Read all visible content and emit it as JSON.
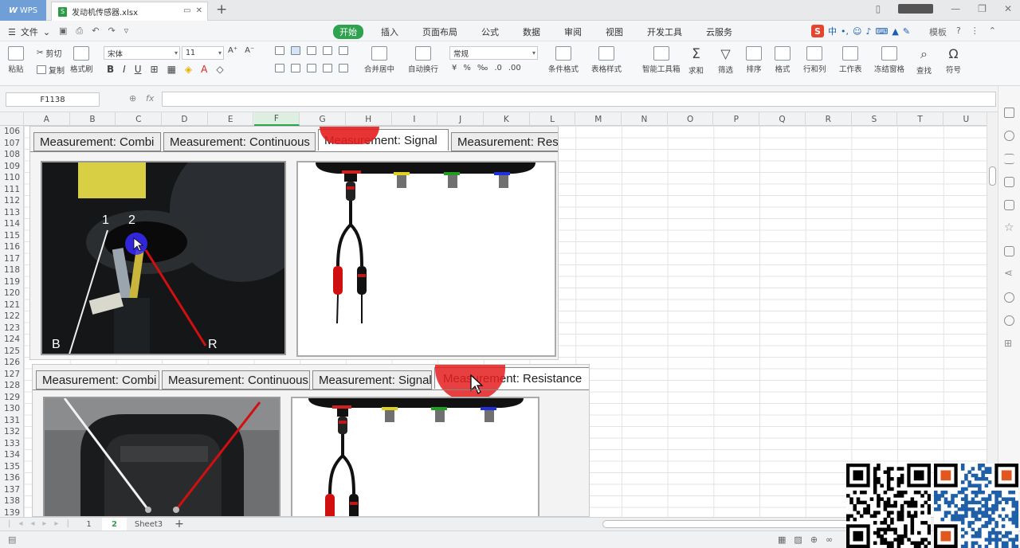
{
  "app": {
    "name": "WPS"
  },
  "doc_tab": {
    "title": "发动机传感器.xlsx"
  },
  "menu": {
    "file": "文件"
  },
  "tabs": [
    {
      "label": "开始",
      "active": true
    },
    {
      "label": "插入"
    },
    {
      "label": "页面布局"
    },
    {
      "label": "公式"
    },
    {
      "label": "数据"
    },
    {
      "label": "审阅"
    },
    {
      "label": "视图"
    },
    {
      "label": "开发工具"
    },
    {
      "label": "云服务"
    }
  ],
  "ime": {
    "logo": "S",
    "lang": "中",
    "dot": "•,",
    "right_label": "模板"
  },
  "ribbon": {
    "paste": "粘贴",
    "cut": "剪切",
    "copy": "复制",
    "format_painter": "格式刷",
    "font_name": "宋体",
    "font_size": "11",
    "bold": "B",
    "italic": "I",
    "underline": "U",
    "merge_center": "合并居中",
    "auto_wrap": "自动换行",
    "number_format": "常规",
    "percent": "%",
    "conditional_format": "条件格式",
    "table_style": "表格样式",
    "smart_toolbox": "智能工具箱",
    "sum": "求和",
    "filter": "筛选",
    "sort": "排序",
    "format": "格式",
    "row_col": "行和列",
    "worksheet": "工作表",
    "freeze": "冻结窗格",
    "find": "查找",
    "symbol": "符号"
  },
  "formula_bar": {
    "cell_ref": "F1138",
    "fx": "fx",
    "content": ""
  },
  "columns": [
    "A",
    "B",
    "C",
    "D",
    "E",
    "F",
    "G",
    "H",
    "I",
    "J",
    "K",
    "L",
    "M",
    "N",
    "O",
    "P",
    "Q",
    "R",
    "S",
    "T",
    "U"
  ],
  "rows": [
    "106",
    "107",
    "108",
    "109",
    "110",
    "111",
    "112",
    "113",
    "114",
    "115",
    "116",
    "117",
    "118",
    "119",
    "120",
    "121",
    "122",
    "123",
    "124",
    "125",
    "126",
    "127",
    "128",
    "129",
    "130",
    "131",
    "132",
    "133",
    "134",
    "135",
    "136",
    "137",
    "138",
    "139"
  ],
  "picture1": {
    "tabs": [
      "Measurement: Combi",
      "Measurement: Continuous",
      "Measurement: Signal",
      "Measurement: Resi"
    ],
    "photo_labels": {
      "pin1": "1",
      "pin2": "2",
      "left": "B",
      "right": "R"
    }
  },
  "picture2": {
    "tabs": [
      "Measurement: Combi",
      "Measurement: Continuous",
      "Measurement: Signal",
      "Measurement: Resistance"
    ]
  },
  "sheets": [
    {
      "label": "1"
    },
    {
      "label": "2",
      "active": true
    },
    {
      "label": "Sheet3"
    }
  ],
  "colors": {
    "accent": "#2fa24f",
    "probe_red": "#e41f1f",
    "wps_blue": "#6f9fd6"
  }
}
